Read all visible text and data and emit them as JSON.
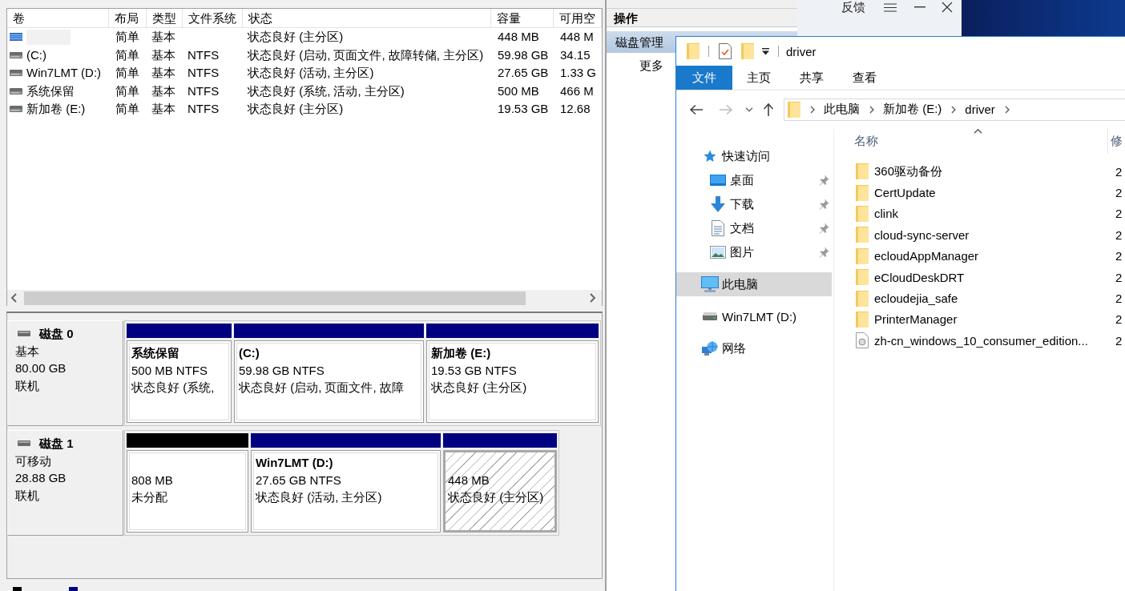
{
  "disk_management": {
    "volume_table": {
      "columns": [
        "卷",
        "布局",
        "类型",
        "文件系统",
        "状态",
        "容量",
        "可用空"
      ],
      "rows": [
        {
          "kind": "striped",
          "name_redacted": true,
          "layout": "简单",
          "type": "基本",
          "status": "状态良好 (主分区)",
          "capacity": "448 MB",
          "free_space": "448 M"
        },
        {
          "kind": "drive",
          "name_redacted": false,
          "name": "(C:)",
          "layout": "简单",
          "type": "基本",
          "file_system": "NTFS",
          "status": "状态良好 (启动, 页面文件, 故障转储, 主分区)",
          "capacity": "59.98 GB",
          "free_space": "34.15"
        },
        {
          "kind": "drive",
          "name_redacted": false,
          "name": "Win7LMT (D:)",
          "layout": "简单",
          "type": "基本",
          "file_system": "NTFS",
          "status": "状态良好 (活动, 主分区)",
          "capacity": "27.65 GB",
          "free_space": "1.33 G"
        },
        {
          "kind": "drive",
          "name_redacted": false,
          "name": "系统保留",
          "layout": "简单",
          "type": "基本",
          "file_system": "NTFS",
          "status": "状态良好 (系统, 活动, 主分区)",
          "capacity": "500 MB",
          "free_space": "466 M"
        },
        {
          "kind": "drive",
          "name_redacted": false,
          "name": "新加卷 (E:)",
          "layout": "简单",
          "type": "基本",
          "file_system": "NTFS",
          "status": "状态良好 (主分区)",
          "capacity": "19.53 GB",
          "free_space": "12.68"
        }
      ]
    },
    "disks": [
      {
        "name": "磁盘 0",
        "type": "基本",
        "size": "80.00 GB",
        "status": "联机",
        "partitions": [
          {
            "kind": "primary",
            "name": "系统保留",
            "size": "500 MB NTFS",
            "status": "状态良好 (系统,",
            "selected": false
          },
          {
            "kind": "primary",
            "name": "(C:)",
            "size": "59.98 GB NTFS",
            "status": "状态良好 (启动, 页面文件, 故障",
            "selected": false
          },
          {
            "kind": "primary",
            "name": "新加卷 (E:)",
            "size": "19.53 GB NTFS",
            "status": "状态良好 (主分区)",
            "selected": false
          }
        ]
      },
      {
        "name": "磁盘 1",
        "type": "可移动",
        "size": "28.88 GB",
        "status": "联机",
        "partitions": [
          {
            "kind": "unallocated",
            "size": "808 MB",
            "status": "未分配",
            "selected": false
          },
          {
            "kind": "primary",
            "name": "Win7LMT (D:)",
            "size": "27.65 GB NTFS",
            "status": "状态良好 (活动, 主分区)",
            "selected": false
          },
          {
            "kind": "primary",
            "size": "448 MB",
            "status": "状态良好 (主分区)",
            "selected": true
          }
        ]
      }
    ],
    "legend": [
      {
        "color": "#000000"
      },
      {
        "color": "#000080"
      }
    ]
  },
  "actions_pane": {
    "title": "操作",
    "section": "磁盘管理",
    "items": [
      "更多"
    ]
  },
  "feedback_window": {
    "title": "反馈"
  },
  "explorer": {
    "title": "driver",
    "ribbon_tabs": [
      {
        "label": "文件",
        "selected": true
      },
      {
        "label": "主页",
        "selected": false
      },
      {
        "label": "共享",
        "selected": false
      },
      {
        "label": "查看",
        "selected": false
      }
    ],
    "nav_buttons": [
      {
        "kind": "back",
        "disabled": false
      },
      {
        "kind": "forward",
        "disabled": true
      },
      {
        "kind": "recent",
        "disabled": false
      },
      {
        "kind": "up",
        "disabled": false
      }
    ],
    "breadcrumb": [
      "此电脑",
      "新加卷 (E:)",
      "driver"
    ],
    "nav_pane": [
      {
        "kind": "star",
        "label": "快速访问",
        "selected": false,
        "children": [
          {
            "kind": "desktop",
            "label": "桌面",
            "selected": false,
            "pinned": true
          },
          {
            "kind": "downloads",
            "label": "下载",
            "selected": false,
            "pinned": true
          },
          {
            "kind": "documents",
            "label": "文档",
            "selected": false,
            "pinned": true
          },
          {
            "kind": "pictures",
            "label": "图片",
            "selected": false,
            "pinned": true
          }
        ]
      },
      {
        "kind": "computer",
        "label": "此电脑",
        "selected": true
      },
      {
        "kind": "drive",
        "label": "Win7LMT (D:)",
        "selected": false
      },
      {
        "kind": "network",
        "label": "网络",
        "selected": false
      }
    ],
    "file_columns": [
      {
        "label": "名称",
        "sorted": true
      },
      {
        "label": "修",
        "sorted": false
      }
    ],
    "files": [
      {
        "kind": "folder",
        "name": "360驱动备份",
        "column_2": "2"
      },
      {
        "kind": "folder",
        "name": "CertUpdate",
        "column_2": "2"
      },
      {
        "kind": "folder",
        "name": "clink",
        "column_2": "2"
      },
      {
        "kind": "folder",
        "name": "cloud-sync-server",
        "column_2": "2"
      },
      {
        "kind": "folder",
        "name": "ecloudAppManager",
        "column_2": "2"
      },
      {
        "kind": "folder",
        "name": "eCloudDeskDRT",
        "column_2": "2"
      },
      {
        "kind": "folder",
        "name": "ecloudejia_safe",
        "column_2": "2"
      },
      {
        "kind": "folder",
        "name": "PrinterManager",
        "column_2": "2"
      },
      {
        "kind": "file",
        "name": "zh-cn_windows_10_consumer_edition...",
        "column_2": "2"
      }
    ]
  }
}
